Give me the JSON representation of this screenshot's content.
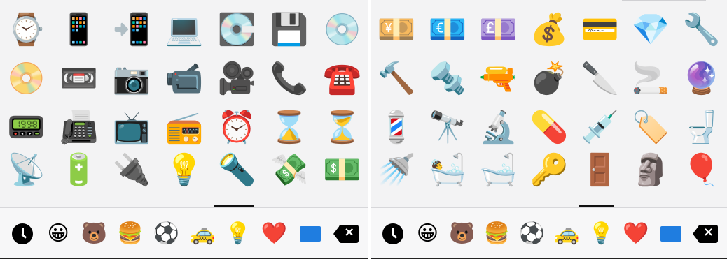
{
  "left_panel": {
    "emojis": [
      "⌚",
      "📱",
      "📲",
      "💻",
      "💽",
      "💾",
      "💿",
      "📀",
      "📼",
      "📷",
      "📹",
      "🎥",
      "📞",
      "☎️",
      "📟",
      "📠",
      "📺",
      "📻",
      "⏰",
      "⌛",
      "⏳",
      "📡",
      "🔋",
      "🔌",
      "💡",
      "🔦",
      "💸",
      "💵"
    ],
    "categories": {
      "recent": "recent-clock",
      "smileys": "😀",
      "animals": "🐻",
      "food": "🍔",
      "activity": "⚽",
      "travel": "🚕",
      "objects": "💡",
      "symbols": "❤️",
      "flags": "flag",
      "delete": "×"
    }
  },
  "right_panel": {
    "emojis": [
      "💴",
      "💶",
      "💷",
      "💰",
      "💳",
      "💎",
      "🔧",
      "🔨",
      "🔩",
      "🔫",
      "💣",
      "🔪",
      "🚬",
      "🔮",
      "💈",
      "🔭",
      "🔬",
      "💊",
      "💉",
      "🏷️",
      "🚽",
      "🚿",
      "🛀",
      "🛁",
      "🔑",
      "🚪",
      "🗿",
      "🎈"
    ],
    "categories": {
      "recent": "recent-clock",
      "smileys": "😀",
      "animals": "🐻",
      "food": "🍔",
      "activity": "⚽",
      "travel": "🚕",
      "objects": "💡",
      "symbols": "❤️",
      "flags": "flag",
      "delete": "×"
    }
  }
}
